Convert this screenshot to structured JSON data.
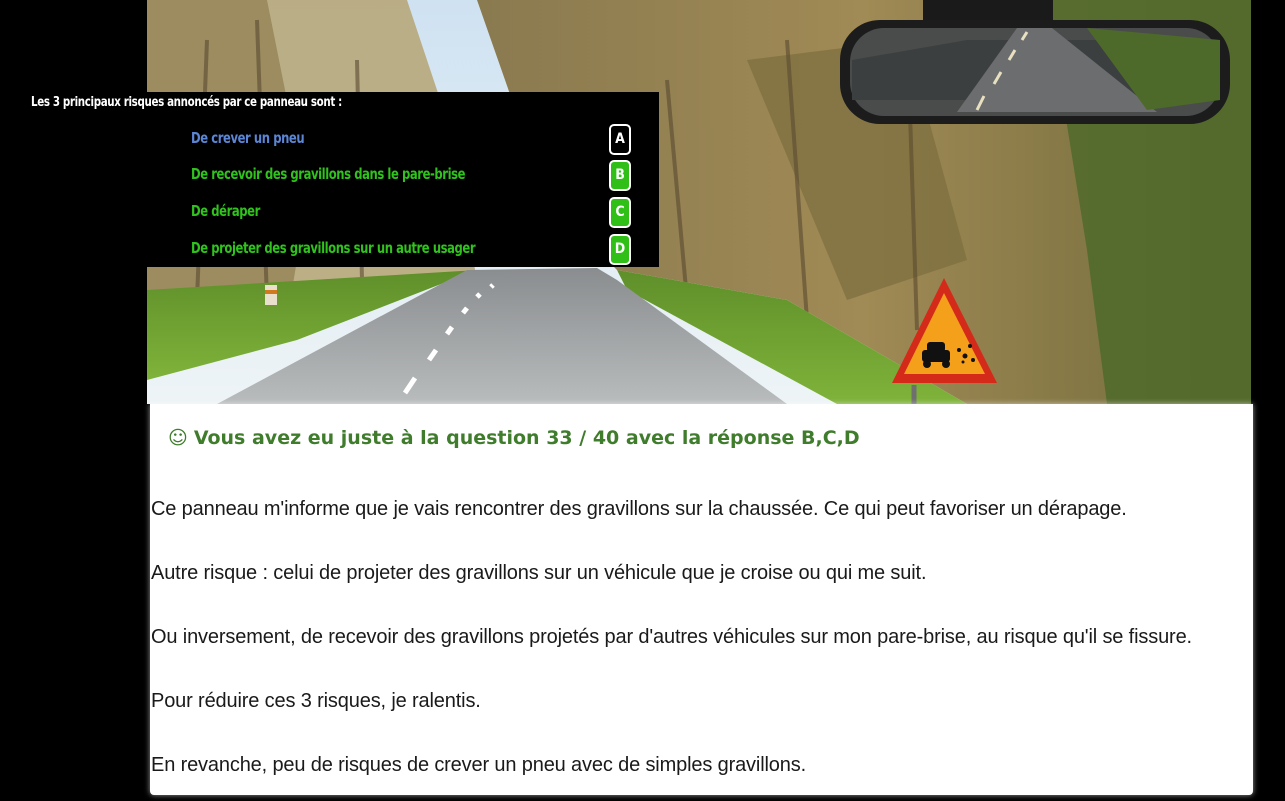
{
  "quiz": {
    "question": "Les 3 principaux risques annoncés par ce panneau sont :",
    "answers": [
      {
        "label": "De crever un pneu",
        "key": "A"
      },
      {
        "label": "De recevoir des gravillons dans le pare-brise",
        "key": "B"
      },
      {
        "label": "De déraper",
        "key": "C"
      },
      {
        "label": "De projeter des gravillons sur un autre usager",
        "key": "D"
      }
    ]
  },
  "result": {
    "smiley": "☺",
    "header": "Vous avez eu juste à la question 33 / 40 avec la réponse B,C,D",
    "paragraphs": [
      "Ce panneau m'informe que je vais rencontrer des gravillons sur la chaussée. Ce qui peut favoriser un dérapage.",
      "Autre risque : celui de projeter des gravillons sur un véhicule que je croise ou qui me suit.",
      "Ou inversement, de recevoir des gravillons projetés par d'autres véhicules sur mon pare-brise, au risque qu'il se fissure.",
      "Pour réduire ces 3 risques, je ralentis.",
      "En revanche, peu de risques de crever un pneu avec de simples gravillons."
    ]
  },
  "colors": {
    "correct_answer": "#30c31d",
    "wrong_answer": "#5b86d6",
    "result_header": "#3f7c2c",
    "sign_fill": "#f5a01a",
    "sign_border": "#d42a1a"
  },
  "icons": {
    "sign": "loose-gravel-warning-sign-icon",
    "mirror": "rearview-mirror-icon"
  }
}
